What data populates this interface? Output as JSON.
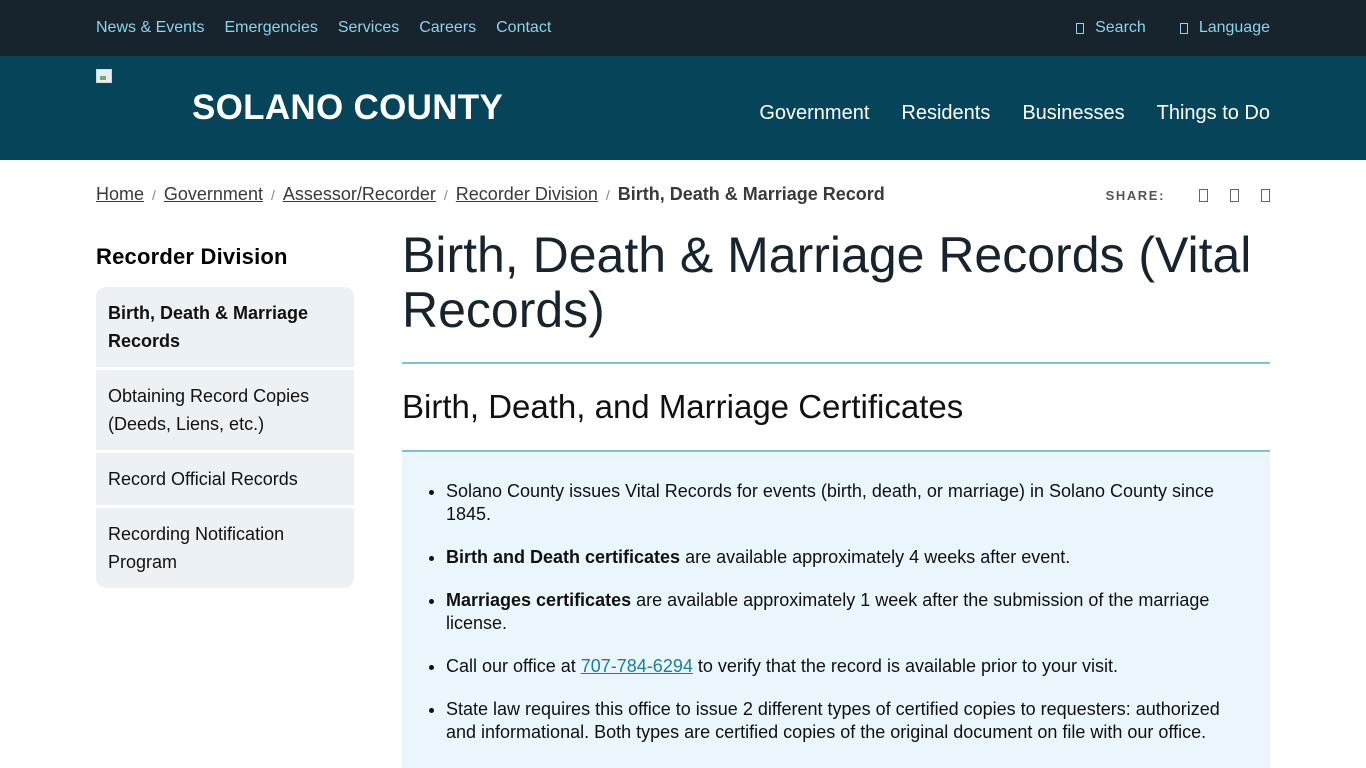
{
  "utility": {
    "links": [
      "News & Events",
      "Emergencies",
      "Services",
      "Careers",
      "Contact"
    ],
    "search_label": "Search",
    "language_label": "Language"
  },
  "header": {
    "site_name": "SOLANO COUNTY",
    "nav": [
      "Government",
      "Residents",
      "Businesses",
      "Things to Do"
    ]
  },
  "breadcrumb": {
    "items": [
      "Home",
      "Government",
      "Assessor/Recorder",
      "Recorder Division"
    ],
    "current": "Birth, Death & Marriage Record"
  },
  "share": {
    "label": "SHARE:",
    "icons": [
      "facebook-icon",
      "twitter-icon",
      "email-icon"
    ]
  },
  "sidebar": {
    "title": "Recorder Division",
    "items": [
      "Birth, Death & Marriage Records",
      "Obtaining Record Copies (Deeds, Liens, etc.)",
      "Record Official Records",
      "Recording Notification Program"
    ]
  },
  "main": {
    "title": "Birth, Death & Marriage Records (Vital Records)",
    "section_heading": "Birth, Death, and Marriage Certificates",
    "bullets": {
      "b1": "Solano County issues Vital Records for events (birth, death, or marriage) in Solano County since 1845.",
      "b2_bold": "Birth and Death certificates",
      "b2_rest": " are available approximately 4 weeks after event.",
      "b3_bold": "Marriages certificates",
      "b3_rest": " are available approximately 1 week after the submission of the marriage license.",
      "b4_pre": "Call our office at ",
      "b4_phone": "707-784-6294",
      "b4_post": " to verify that the record is available prior to your visit.",
      "b5": "State law requires this office to issue 2 different types of certified copies to requesters: authorized and informational. Both types are certified copies of the original document on file with our office."
    }
  },
  "colors": {
    "utility_bg": "#17242e",
    "header_bg": "#064559",
    "utility_link": "#8ad4ec",
    "rule": "#7ec2d6",
    "info_bg": "#eaf6fb",
    "sidebar_bg": "#ecf1f5",
    "link": "#1a7fa6"
  }
}
